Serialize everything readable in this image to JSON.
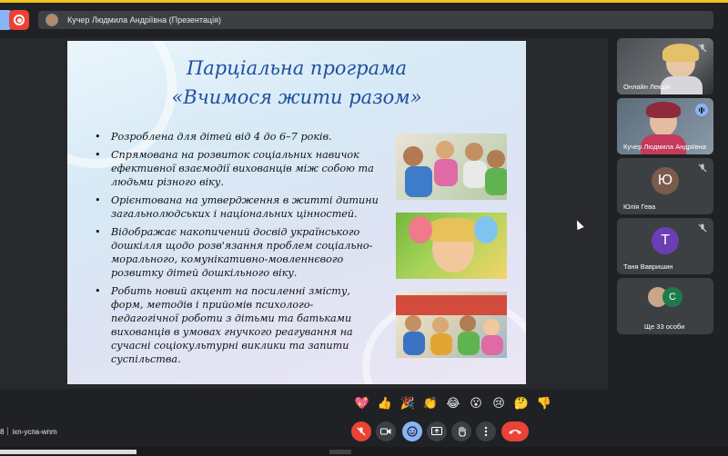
{
  "presenter_bar": {
    "text": "Кучер Людмила Андріївна (Презентація)"
  },
  "slide": {
    "title_line1": "Парціальна програма",
    "title_line2": "«Вчимося жити разом»",
    "bullets": [
      "Розроблена для дітей від 4 до 6–7 років.",
      "Спрямована на розвиток соціальних навичок ефективної взаємодії вихованців між собою та людьми різного віку.",
      "Орієнтована на утвердження в житті дитини загальнолюдських і національних цінностей.",
      "Відображає накопичений досвід українського дошкілля щодо розв'язання проблем соціально-морального, комунікативно-мовленнєвого розвитку дітей дошкільного віку.",
      "Робить новий акцент на посиленні змісту, форм, методів і прийомів психолого-педагогічної роботи з дітьми та батьками вихованців в умовах гнучкого реагування на сучасні соціокультурні виклики та запити суспільства."
    ]
  },
  "participants": [
    {
      "name": "Онлайн Лекція"
    },
    {
      "name": "Кучер Людмила Андріївна"
    },
    {
      "name": "Юлія Гева",
      "initial": "Ю",
      "color": "#7b5b4c"
    },
    {
      "name": "Таня Вавришин",
      "initial": "Т",
      "color": "#6a3fb5"
    },
    {
      "name": "Ще 33 особи",
      "initial": "С",
      "color": "#1e7a4a"
    }
  ],
  "reactions": [
    "💖",
    "👍",
    "🎉",
    "👏",
    "😂",
    "😮",
    "😢",
    "🤔",
    "👎"
  ],
  "meeting": {
    "time_fragment": "8",
    "code": "ixn-ycпa-wnm"
  },
  "colors": {
    "accent": "#8ab4f8",
    "danger": "#ea4335",
    "title_blue": "#1f4f9e"
  }
}
